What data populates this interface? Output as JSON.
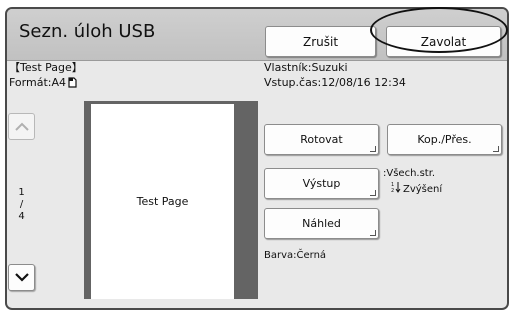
{
  "header": {
    "title": "Sezn. úloh USB",
    "cancel_label": "Zrušit",
    "call_label": "Zavolat"
  },
  "document": {
    "name": "【Test Page】",
    "format": "Formát:A4"
  },
  "job": {
    "owner": "Vlastník:Suzuki",
    "entry_time": "Vstup.čas:12/08/16 12:34",
    "color": "Barva:Černá"
  },
  "preview": {
    "page_text": "Test Page",
    "current_page": "1",
    "separator": "/",
    "total_pages": "4"
  },
  "actions": {
    "rotate_label": "Rotovat",
    "copy_label": "Kop./Přes.",
    "output_label": "Výstup",
    "preview_label": "Náhled"
  },
  "sort": {
    "pages": ":Všech.str.",
    "order": "Zvýšení"
  },
  "icons": {
    "nav_up": "chevron-up-icon",
    "nav_down": "chevron-down-icon",
    "paper": "paper-portrait-icon",
    "sort": "sort-ascending-icon"
  }
}
